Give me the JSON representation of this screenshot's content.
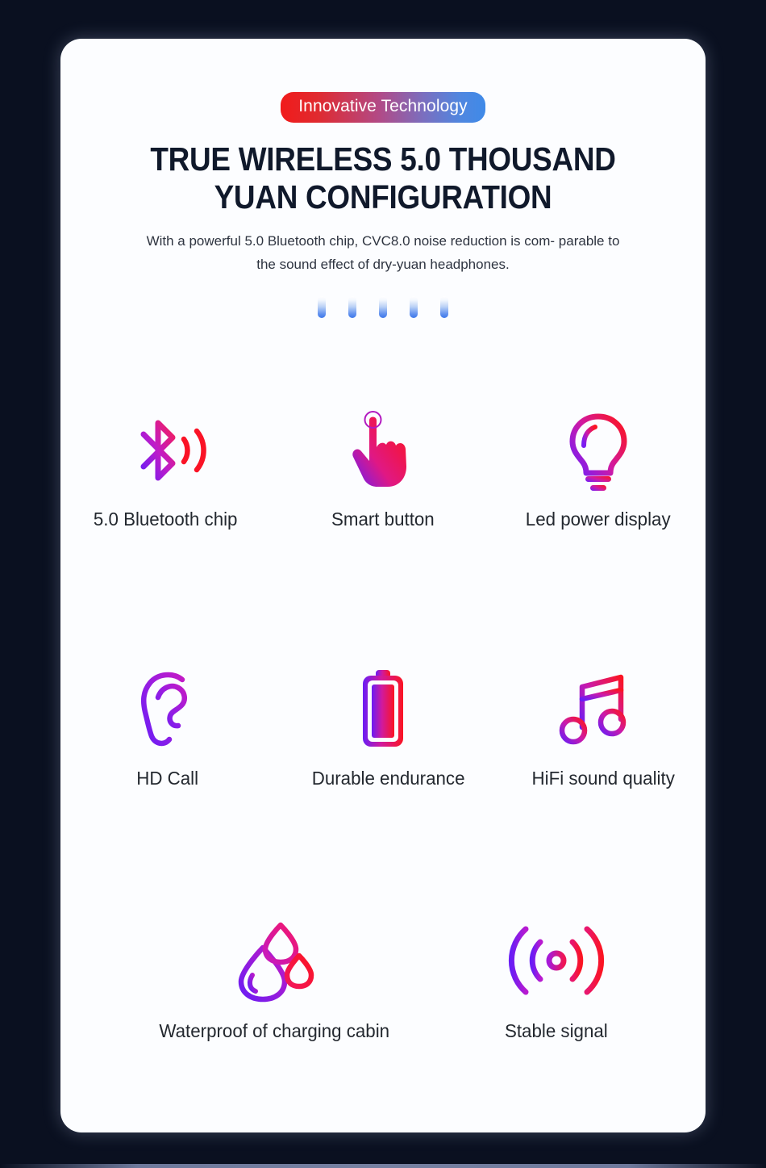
{
  "page": {
    "background_color": "#0a1020",
    "card_color": "#fcfdff"
  },
  "header": {
    "badge_label": "Innovative Technology",
    "badge_gradient_from": "#f11b1b",
    "badge_gradient_to": "#3f8ae8",
    "headline_line1": "TRUE WIRELESS 5.0 THOUSAND",
    "headline_line2": "YUAN CONFIGURATION",
    "headline_color": "#10192b",
    "subtitle_line1": "With a powerful 5.0 Bluetooth chip, CVC8.0 noise reduction is com-",
    "subtitle_line2": "parable to the sound effect of dry-yuan headphones."
  },
  "divider_bars": {
    "count": 5,
    "gradient_from": "#ffffff",
    "gradient_to": "#3d78ea"
  },
  "features": {
    "accent_violet": "#7B2BF0",
    "accent_magenta": "#E91E8C",
    "accent_red": "#FB1523",
    "rows": [
      {
        "items": [
          {
            "icon": "bluetooth-icon",
            "label": "5.0 Bluetooth chip"
          },
          {
            "icon": "touch-hand-icon",
            "label": "Smart button"
          },
          {
            "icon": "lightbulb-icon",
            "label": "Led power display"
          }
        ]
      },
      {
        "items": [
          {
            "icon": "ear-icon",
            "label": "HD Call"
          },
          {
            "icon": "battery-icon",
            "label": "Durable endurance"
          },
          {
            "icon": "music-note-icon",
            "label": "HiFi sound quality"
          }
        ]
      },
      {
        "items": [
          {
            "icon": "water-drops-icon",
            "label": "Waterproof of charging cabin"
          },
          {
            "icon": "signal-waves-icon",
            "label": "Stable signal"
          }
        ]
      }
    ]
  }
}
